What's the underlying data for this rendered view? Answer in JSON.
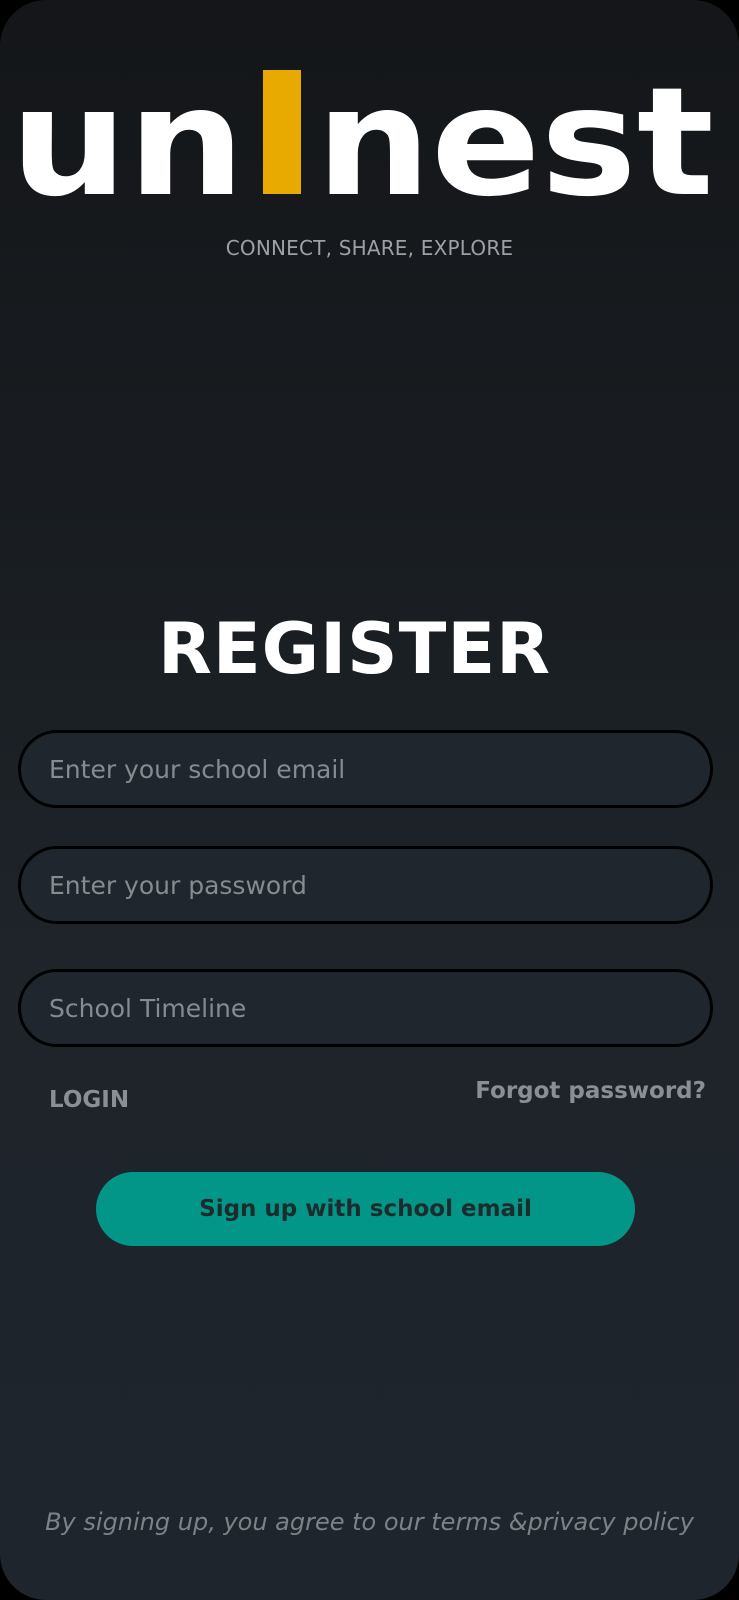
{
  "colors": {
    "background": "#1c2126",
    "logo_white": "#ffffff",
    "logo_accent": "#e8a900",
    "tagline": "#9ca1a6",
    "heading": "#ffffff",
    "link": "#8a8f94",
    "button_bg": "#029688",
    "button_text": "#1e2a2c",
    "terms": "#7d8287"
  },
  "logo": {
    "text_left": "un",
    "text_right": "nest",
    "accent_bar": "i"
  },
  "tagline": "CONNECT, SHARE, EXPLORE",
  "heading": "REGISTER",
  "form": {
    "email": {
      "value": "",
      "placeholder": "Enter your school email"
    },
    "password": {
      "value": "",
      "placeholder": "Enter your password"
    },
    "timeline": {
      "value": "",
      "placeholder": "School Timeline"
    }
  },
  "links": {
    "login": "LOGIN",
    "forgot": "Forgot password?"
  },
  "signup_button": "Sign up with school email",
  "terms": "By signing up, you agree to our terms &privacy policy"
}
